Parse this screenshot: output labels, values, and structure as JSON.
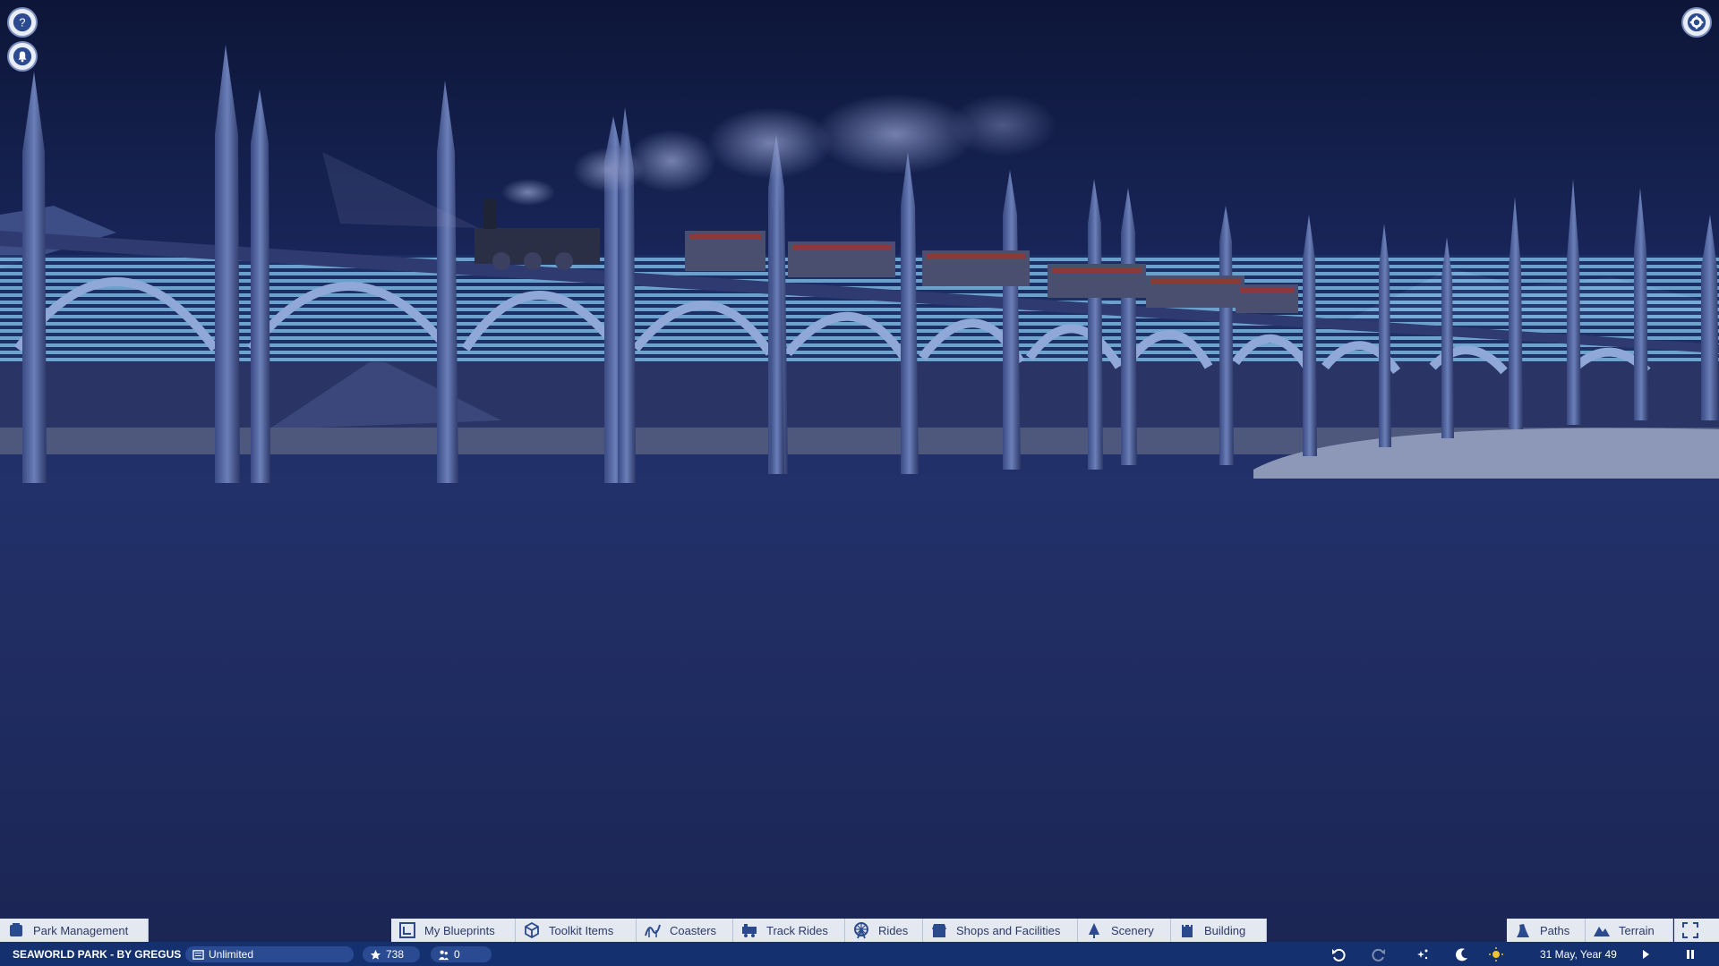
{
  "park": {
    "name": "SEAWORLD PARK - BY GREGUS",
    "money": "Unlimited",
    "rating": "738",
    "guests": "0",
    "date": "31 May, Year 49"
  },
  "top_buttons": {
    "help": "help-icon",
    "notifications": "bell-icon",
    "settings": "gear-icon"
  },
  "toolbar": {
    "left": {
      "label": "Park Management",
      "icon": "park-management-icon"
    },
    "center": [
      {
        "label": "My Blueprints",
        "icon": "blueprint-icon"
      },
      {
        "label": "Toolkit Items",
        "icon": "cube-icon"
      },
      {
        "label": "Coasters",
        "icon": "coaster-icon"
      },
      {
        "label": "Track Rides",
        "icon": "train-icon"
      },
      {
        "label": "Rides",
        "icon": "ferris-wheel-icon"
      },
      {
        "label": "Shops and Facilities",
        "icon": "shop-icon"
      },
      {
        "label": "Scenery",
        "icon": "tree-icon"
      },
      {
        "label": "Building",
        "icon": "castle-icon"
      }
    ],
    "right": [
      {
        "label": "Paths",
        "icon": "path-icon"
      },
      {
        "label": "Terrain",
        "icon": "mountain-icon"
      }
    ],
    "camera": "camera-frame-icon"
  },
  "controls": [
    "undo-icon",
    "redo-icon",
    "fireworks-icon",
    "day-night-icon",
    "weather-sun-icon",
    "play-icon",
    "pause-icon"
  ],
  "colors": {
    "toolbar_bg": "#e4e8f0",
    "toolbar_text": "#2b3a66",
    "statusbar_bg": "#14306e",
    "night_sky": "#17214d"
  }
}
